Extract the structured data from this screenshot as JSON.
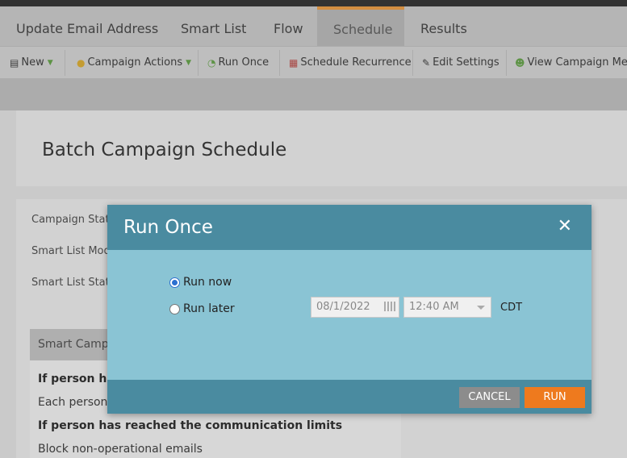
{
  "tabs": [
    {
      "label": "Update Email Address",
      "active": false
    },
    {
      "label": "Smart List",
      "active": false
    },
    {
      "label": "Flow",
      "active": false
    },
    {
      "label": "Schedule",
      "active": true
    },
    {
      "label": "Results",
      "active": false
    }
  ],
  "toolbar": {
    "new_label": "New",
    "campaign_actions_label": "Campaign Actions",
    "run_once_label": "Run Once",
    "schedule_recurrence_label": "Schedule Recurrence",
    "edit_settings_label": "Edit Settings",
    "view_campaign_members_label": "View Campaign Mem"
  },
  "page": {
    "title": "Batch Campaign Schedule",
    "fields": {
      "campaign_status": "Campaign Stat",
      "smart_list_mode": "Smart List Mod",
      "smart_list_status": "Smart List Stat"
    },
    "smart_campaign_panel": {
      "header": "Smart Campa",
      "line1": "If person has",
      "line2": "Each person c",
      "line3": "If person has reached the communication limits",
      "line4": "Block non-operational emails"
    }
  },
  "dialog": {
    "title": "Run Once",
    "close_glyph": "✕",
    "run_now_label": "Run now",
    "run_later_label": "Run later",
    "run_now_selected": true,
    "date_value": "08/1/2022",
    "time_value": "12:40 AM",
    "timezone": "CDT",
    "cancel_label": "CANCEL",
    "run_label": "RUN"
  },
  "colors": {
    "dialog_header": "#4a8ba0",
    "dialog_body": "#8ac4d4",
    "run_button": "#ee7a1e",
    "cancel_button": "#8c8c8c",
    "active_tab_accent": "#f0a24b"
  }
}
